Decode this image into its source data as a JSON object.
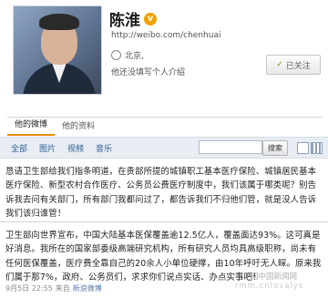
{
  "profile": {
    "name": "陈淮",
    "verified_badge": "v",
    "url": "http://weibo.com/chenhuai",
    "location": "北京,",
    "bio": "他还没填写个人介绍",
    "follow_label": "已关注",
    "follow_mark": "✓"
  },
  "tabs": [
    {
      "label": "他的微博",
      "active": true
    },
    {
      "label": "他的资料",
      "active": false
    }
  ],
  "filters": {
    "items": [
      "全部",
      "图片",
      "视频",
      "音乐"
    ],
    "search_placeholder": "",
    "search_label": "搜索"
  },
  "posts": [
    {
      "text": "恳请卫生部给我们指条明道，在贵部所提的城镇职工基本医疗保险、城镇居民基本医疗保险、新型农村合作医疗、公务员公费医疗制度中，我们该属于哪类呢？别告诉我去问有关部门，所有部门我都问过了，都告诉我们不归他们管，就是没人告诉我们该归谁管！"
    },
    {
      "text": "卫生部向世界宣布，中国大陆基本医保覆盖逾12.5亿人，覆盖面达93%。这可真是好消息。我所在的国家部委级高端研究机构，所有研究人员均具高级职称，尚未有任何医保覆盖，医疗费全靠自己的20余人小单位硬撑，由10年呼吁无人睬。原来我们属于那7%，政府、公务员们，求求你们说点实话、办点实事吧！"
    }
  ],
  "meta": {
    "date": "9月5日 22:55",
    "via": "来自",
    "source": "新浪微博"
  },
  "watermark": {
    "line1": "今上网中国新闻网",
    "line2": "rmm.cnlovalys"
  },
  "colors": {
    "accent": "#f08a00",
    "link": "#2d5c92",
    "toolbar_bg": "#e7edf3"
  }
}
